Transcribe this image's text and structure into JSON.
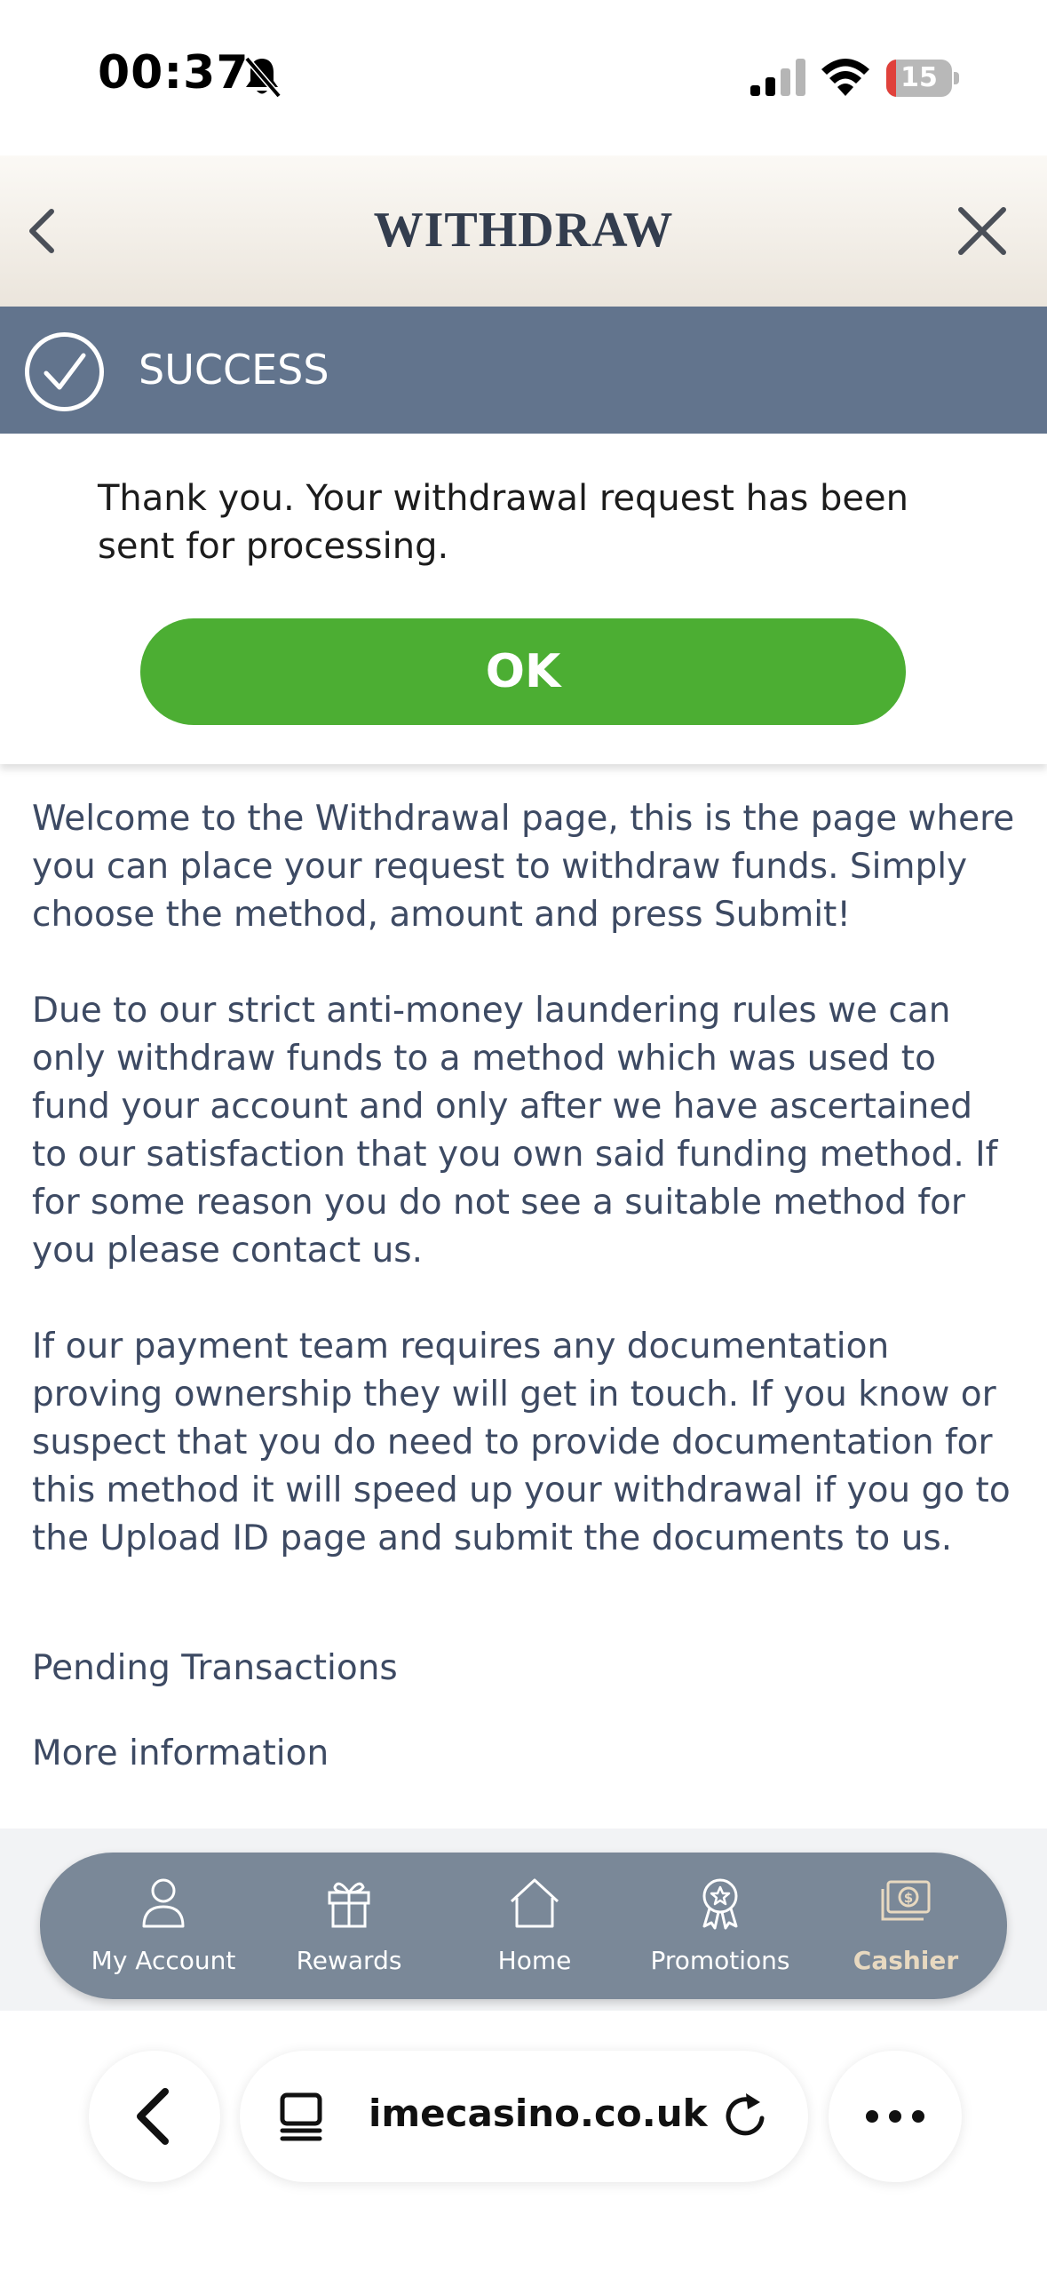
{
  "status_bar": {
    "time": "00:37",
    "battery": "15",
    "battery_level_percent": 15,
    "icons": [
      "bell-slash-icon",
      "cellular-signal-icon",
      "wifi-icon",
      "battery-icon"
    ]
  },
  "header": {
    "title": "WITHDRAW",
    "back_icon": "chevron-left-icon",
    "close_icon": "close-icon",
    "background": "#f2eee8",
    "title_color": "#333d4e"
  },
  "success": {
    "label": "SUCCESS",
    "icon": "check-circle-icon",
    "background": "#62748d",
    "message": "Thank you. Your withdrawal request has been sent for processing.",
    "ok_label": "OK",
    "ok_color": "#4cae33"
  },
  "content": {
    "paragraphs": [
      "Welcome to the Withdrawal page, this is the page where you can place your request to withdraw funds. Simply choose the method, amount and press Submit!",
      "Due to our strict anti-money laundering rules we can only withdraw funds to a method which was used to fund your account and only after we have ascertained to our satisfaction that you own said funding method. If for some reason you do not see a suitable method for you please contact us.",
      "If our payment team requires any documentation proving ownership they will get in touch. If you know or suspect that you do need to provide documentation for this method it will speed up your withdrawal if you go to the Upload ID page and submit the documents to us."
    ],
    "links": [
      "Pending Transactions",
      "More information"
    ],
    "text_color": "#3d4a63"
  },
  "bottom_nav": {
    "background": "#7a8898",
    "active_color": "#e8d9c0",
    "items": [
      {
        "label": "My Account",
        "icon": "user-icon"
      },
      {
        "label": "Rewards",
        "icon": "gift-icon"
      },
      {
        "label": "Home",
        "icon": "home-icon"
      },
      {
        "label": "Promotions",
        "icon": "award-badge-icon"
      },
      {
        "label": "Cashier",
        "icon": "cash-icon",
        "active": true
      }
    ]
  },
  "browser": {
    "url": "imecasino.co.uk",
    "icons": [
      "back-arrow-icon",
      "tabs-icon",
      "reload-icon",
      "more-icon"
    ]
  }
}
